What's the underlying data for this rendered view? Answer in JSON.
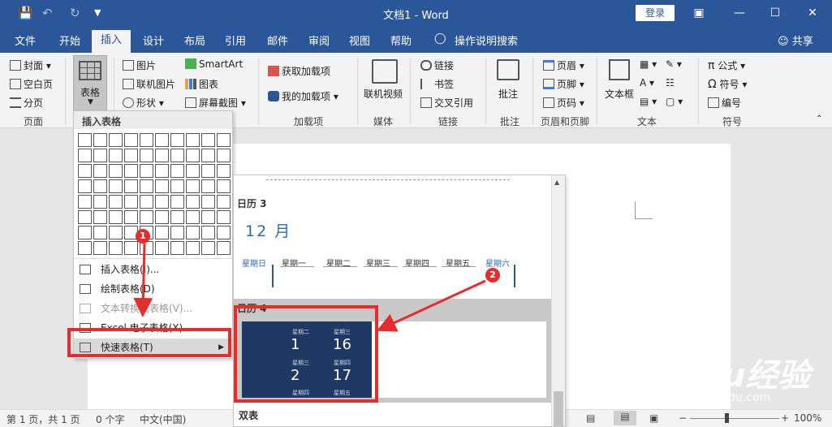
{
  "window": {
    "title": "文档1 - Word",
    "login": "登录"
  },
  "menu": {
    "tabs": [
      "文件",
      "开始",
      "插入",
      "设计",
      "布局",
      "引用",
      "邮件",
      "审阅",
      "视图",
      "帮助"
    ],
    "active": "插入",
    "tell_me": "操作说明搜索",
    "share": "共享"
  },
  "ribbon": {
    "pages": {
      "cover": "封面",
      "blank": "空白页",
      "break": "分页",
      "group": "页面"
    },
    "table": {
      "label": "表格"
    },
    "illustrations": {
      "picture": "图片",
      "online_picture": "联机图片",
      "shapes": "形状",
      "smartart": "SmartArt",
      "chart": "图表",
      "screenshot": "屏幕截图"
    },
    "addins": {
      "get": "获取加载项",
      "mine": "我的加载项",
      "group": "加载项"
    },
    "media": {
      "online_video": "联机视频",
      "group": "媒体"
    },
    "links": {
      "link": "链接",
      "bookmark": "书签",
      "cross_ref": "交叉引用",
      "group": "链接"
    },
    "comments": {
      "comment": "批注",
      "group": "批注"
    },
    "header_footer": {
      "header": "页眉",
      "footer": "页脚",
      "page_number": "页码",
      "group": "页眉和页脚"
    },
    "text": {
      "textbox": "文本框",
      "group": "文本"
    },
    "symbols": {
      "equation": "公式",
      "symbol": "符号",
      "number": "编号",
      "group": "符号"
    }
  },
  "table_dropdown": {
    "header": "插入表格",
    "items": [
      "插入表格(I)...",
      "绘制表格(D)",
      "文本转换成表格(V)...",
      "Excel 电子表格(X)",
      "快速表格(T)"
    ]
  },
  "gallery": {
    "calendar3_label": "日历 3",
    "month": "12 月",
    "weekdays": [
      "星期日",
      "星期一",
      "星期二",
      "星期三",
      "星期四",
      "星期五",
      "星期六"
    ],
    "calendar4_label": "日历 4",
    "preview": {
      "d1_top": "星期二",
      "d1": "1",
      "d2_top": "星期三",
      "d2": "16",
      "d3_top": "星期三",
      "d3": "2",
      "d4_top": "星期四",
      "d4": "17",
      "d3_bottom": "星期四",
      "d4_bottom": "星期五"
    },
    "dual_label": "双表"
  },
  "annotations": {
    "badge1": "1",
    "badge2": "2"
  },
  "status": {
    "page": "第 1 页，共 1 页",
    "words": "0 个字",
    "lang": "中文(中国)",
    "zoom": "100%"
  },
  "watermark": {
    "main": "Baidu经验",
    "sub": "jingyan.baidu.com"
  }
}
